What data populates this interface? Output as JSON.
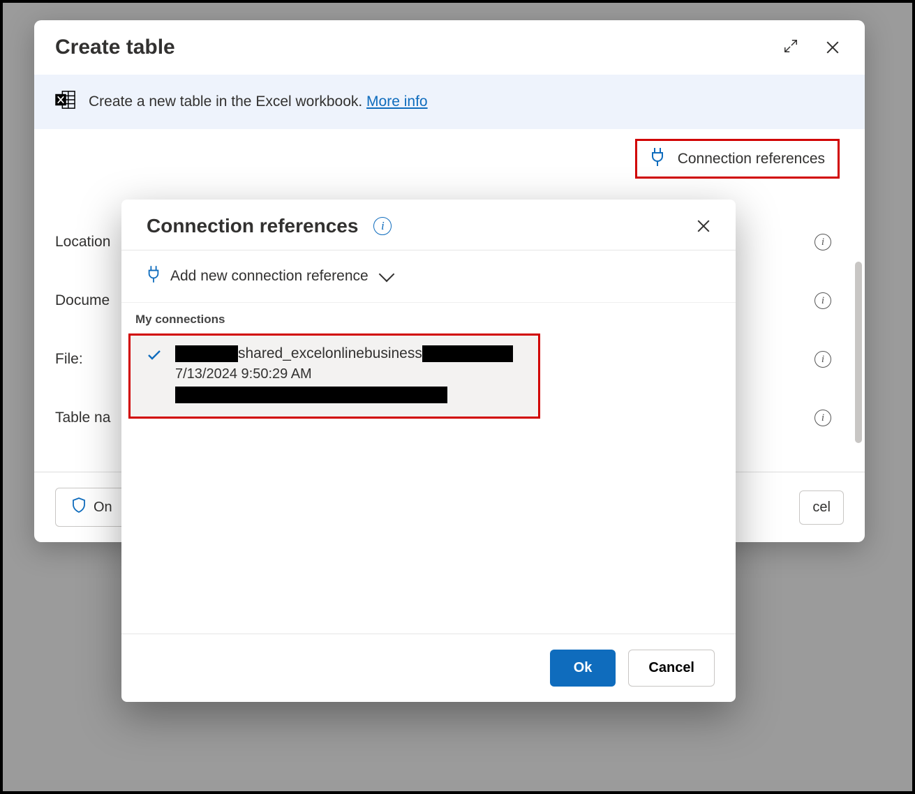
{
  "dialog": {
    "title": "Create table",
    "banner_text": "Create a new table in the Excel workbook. ",
    "banner_link": "More info",
    "conn_ref_button": "Connection references",
    "form": {
      "location_label": "Location",
      "document_label": "Docume",
      "file_label": "File:",
      "table_label": "Table na"
    },
    "footer": {
      "only_label": "On",
      "right_partial": "cel"
    }
  },
  "popover": {
    "title": "Connection references",
    "add_label": "Add new connection reference",
    "section_label": "My connections",
    "connection": {
      "name_mid": "shared_excelonlinebusiness",
      "date": "7/13/2024 9:50:29 AM"
    },
    "ok_label": "Ok",
    "cancel_label": "Cancel"
  }
}
